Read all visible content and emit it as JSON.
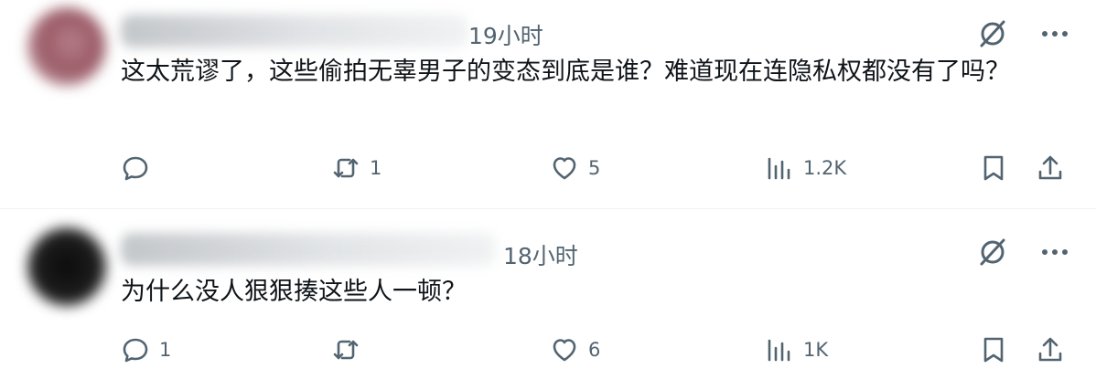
{
  "posts": [
    {
      "time": "19小时",
      "text": "这太荒谬了，这些偷拍无辜男子的变态到底是谁？难道现在连隐私权都没有了吗？",
      "stats": {
        "replies": "",
        "reposts": "1",
        "likes": "5",
        "views": "1.2K"
      }
    },
    {
      "time": "18小时",
      "text": "为什么没人狠狠揍这些人一顿？",
      "stats": {
        "replies": "1",
        "reposts": "",
        "likes": "6",
        "views": "1K"
      }
    }
  ],
  "icons": {
    "reply": "reply-icon",
    "repost": "repost-icon",
    "like": "heart-icon",
    "views": "views-icon",
    "bookmark": "bookmark-icon",
    "share": "share-icon",
    "grok": "grok-icon",
    "more": "more-icon"
  },
  "colors": {
    "muted": "#536471",
    "text": "#0f1419",
    "divider": "#eff3f4"
  }
}
